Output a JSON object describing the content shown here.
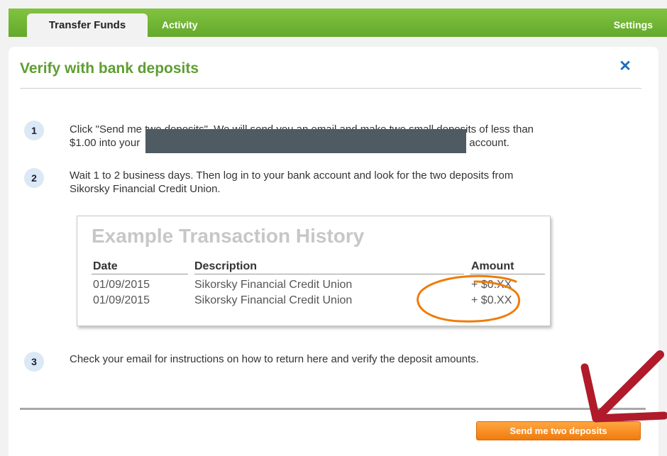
{
  "tabs": {
    "transfer_funds": "Transfer Funds",
    "activity": "Activity",
    "settings": "Settings"
  },
  "dialog": {
    "title": "Verify with bank deposits",
    "close_icon": "close-x-icon",
    "steps": [
      {
        "number": "1",
        "text_line1": "Click \"Send me two deposits\". We will send you an email and make two small deposits of less than",
        "text_line2_before": "$1.00 into your",
        "text_line2_after": "account."
      },
      {
        "number": "2",
        "text_line1": "Wait 1 to 2 business days. Then log in to your bank account and look for the two deposits from",
        "text_line2": "Sikorsky Financial Credit Union."
      },
      {
        "number": "3",
        "text": "Check your email for instructions on how to return here and verify the deposit amounts."
      }
    ],
    "example": {
      "title": "Example Transaction History",
      "headers": {
        "date": "Date",
        "description": "Description",
        "amount": "Amount"
      },
      "rows": [
        {
          "date": "01/09/2015",
          "description": "Sikorsky Financial Credit Union",
          "amount": "+ $0.XX"
        },
        {
          "date": "01/09/2015",
          "description": "Sikorsky Financial Credit Union",
          "amount": "+ $0.XX"
        }
      ]
    },
    "send_button": "Send me two deposits"
  },
  "colors": {
    "brand_green": "#63a92b",
    "title_green": "#5e9e32",
    "button_orange": "#f07b0c",
    "annotation_orange": "#f07b0c",
    "arrow_red": "#b01a2a",
    "redaction": "#4f5b63"
  }
}
